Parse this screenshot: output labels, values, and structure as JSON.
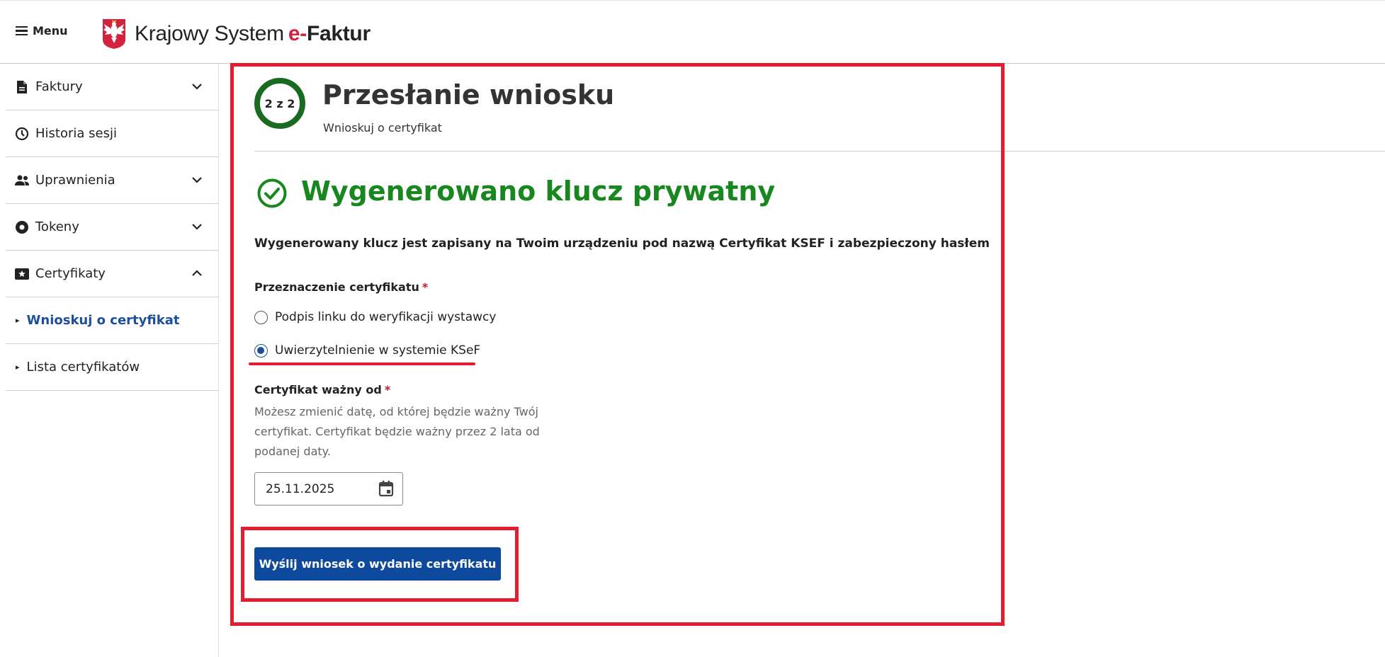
{
  "header": {
    "menu_label": "Menu",
    "brand_prefix": "Krajowy System",
    "brand_e": "e-",
    "brand_suffix": "Faktur"
  },
  "sidebar": {
    "items": [
      {
        "label": "Faktury",
        "icon": "document-icon",
        "expanded": false
      },
      {
        "label": "Historia sesji",
        "icon": "clock-icon"
      },
      {
        "label": "Uprawnienia",
        "icon": "people-icon",
        "expanded": false
      },
      {
        "label": "Tokeny",
        "icon": "token-icon",
        "expanded": false
      },
      {
        "label": "Certyfikaty",
        "icon": "certificate-icon",
        "expanded": true
      }
    ],
    "subitems": [
      {
        "label": "Wnioskuj o certyfikat",
        "active": true
      },
      {
        "label": "Lista certyfikatów",
        "active": false
      }
    ]
  },
  "main": {
    "step": "2 z 2",
    "title": "Przesłanie wniosku",
    "subtitle": "Wnioskuj o certyfikat",
    "success_title": "Wygenerowano klucz prywatny",
    "info_text": "Wygenerowany klucz jest zapisany na Twoim urządzeniu pod nazwą Certyfikat KSEF i zabezpieczony hasłem",
    "purpose_label": "Przeznaczenie certyfikatu",
    "required_mark": "*",
    "purpose_options": [
      {
        "label": "Podpis linku do weryfikacji wystawcy",
        "checked": false
      },
      {
        "label": "Uwierzytelnienie w systemie KSeF",
        "checked": true
      }
    ],
    "valid_from_label": "Certyfikat ważny od",
    "valid_from_help": "Możesz zmienić datę, od której będzie ważny Twój certyfikat. Certyfikat będzie ważny przez 2 lata od podanej daty.",
    "valid_from_value": "25.11.2025",
    "submit_label": "Wyślij wniosek o wydanie certyfikatu"
  },
  "colors": {
    "success": "#18871f",
    "primary": "#0d4a9e",
    "annotation": "#e11d2f",
    "step_ring": "#1a6b22"
  }
}
